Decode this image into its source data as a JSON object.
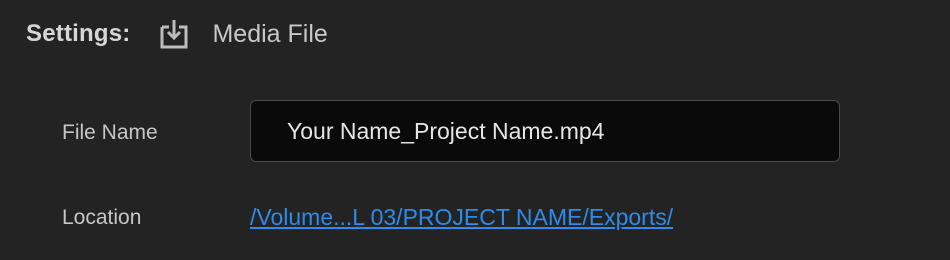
{
  "header": {
    "settings_label": "Settings:",
    "export_icon": "export-to-file-icon",
    "media_label": "Media File"
  },
  "file_name": {
    "label": "File Name",
    "value": "Your Name_Project Name.mp4"
  },
  "location": {
    "label": "Location",
    "path": "/Volume...L 03/PROJECT NAME/Exports/"
  },
  "colors": {
    "background": "#232323",
    "input_background": "#0a0a0a",
    "link": "#2d8ceb",
    "text": "#c6c6c6"
  }
}
